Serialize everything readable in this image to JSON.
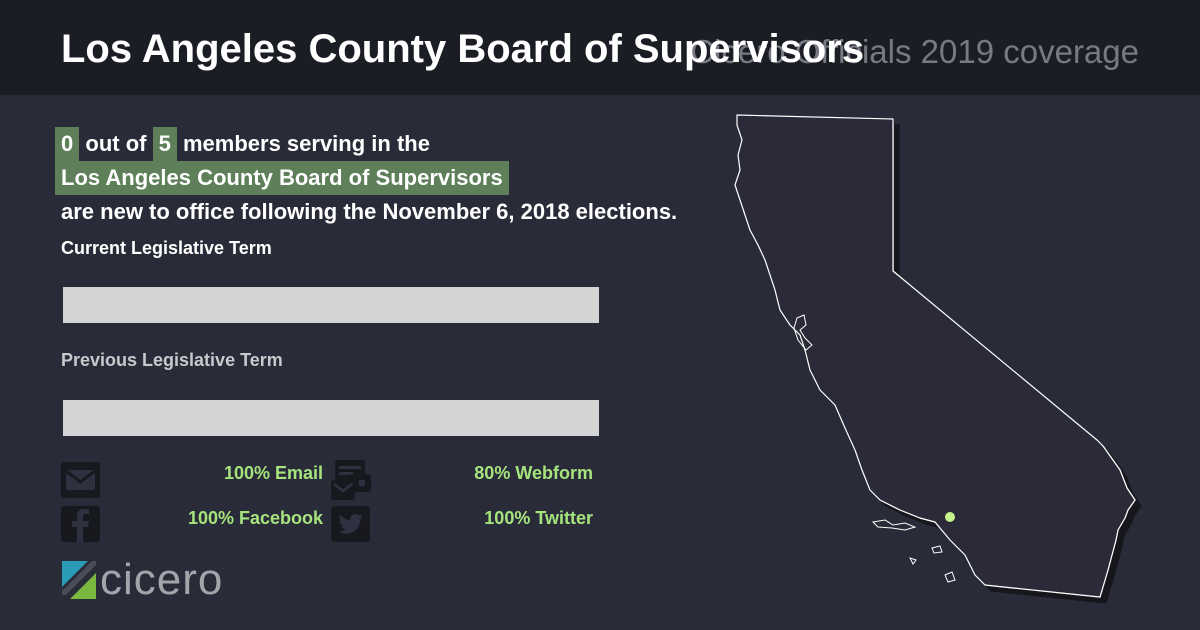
{
  "header": {
    "title": "Los Angeles County Board of Supervisors",
    "subtitle": "Cicero Officials 2019 coverage"
  },
  "summary": {
    "new_count": "0",
    "text_out_of": "out of",
    "total_count": "5",
    "text_members": "members serving in the",
    "body_name": "Los Angeles County Board of Supervisors",
    "text_rest": "are new to office following the November 6, 2018 elections."
  },
  "terms": {
    "current_label": "Current Legislative Term",
    "current_fill": 0,
    "previous_label": "Previous Legislative Term",
    "previous_fill": 0
  },
  "contacts": {
    "email": {
      "label": "100% Email",
      "icon": "envelope-icon"
    },
    "webform": {
      "label": "80% Webform",
      "icon": "webform-icon"
    },
    "facebook": {
      "label": "100% Facebook",
      "icon": "facebook-icon"
    },
    "twitter": {
      "label": "100% Twitter",
      "icon": "twitter-icon"
    }
  },
  "logo": {
    "text": "cicero"
  },
  "map": {
    "region": "California",
    "marker": "Los Angeles County",
    "marker_color": "#c6f28a"
  },
  "colors": {
    "background": "#292c38",
    "header": "#1b1d24",
    "highlight": "#5e7f5a",
    "accent_text": "#a6e37d",
    "bar_empty": "#d4d4d4"
  }
}
